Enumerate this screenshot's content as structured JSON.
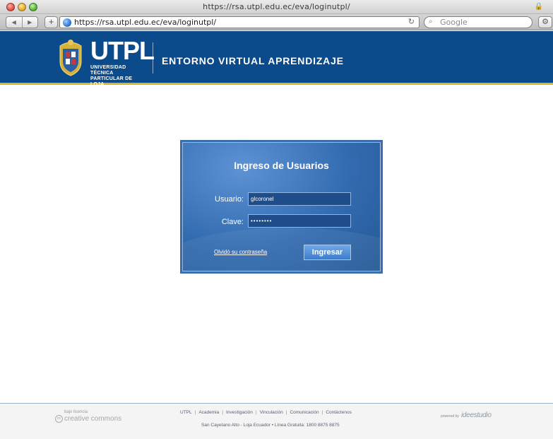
{
  "browser": {
    "window_title": "https://rsa.utpl.edu.ec/eva/loginutpl/",
    "url": "https://rsa.utpl.edu.ec/eva/loginutpl/",
    "search_placeholder": "Google",
    "nav_back": "◀",
    "nav_forward": "▶",
    "add_label": "+",
    "reload_label": "C"
  },
  "header": {
    "brand": "UTPL",
    "brand_subtitle_line1": "UNIVERSIDAD TÉCNICA",
    "brand_subtitle_line2": "PARTICULAR DE LOJA",
    "environment_title": "ENTORNO VIRTUAL APRENDIZAJE",
    "colors": {
      "background": "#0b4a8b",
      "accent": "#d9b72a"
    }
  },
  "login": {
    "title": "Ingreso de Usuarios",
    "username_label": "Usuario:",
    "username_value": "glcoronel",
    "password_label": "Clave:",
    "password_value": "••••••••",
    "forgot_link": "Olvidó su contraseña",
    "submit_label": "Ingresar"
  },
  "footer": {
    "license_label": "bajo licencia",
    "cc_label": "creative commons",
    "links": [
      "UTPL",
      "Academia",
      "Investigación",
      "Vinculación",
      "Comunicación",
      "Contáctenos"
    ],
    "address": "San Cayetano Alto - Loja Ecuador • Línea Gratuita: 1800 8875 8875",
    "powered_by": "powered by",
    "powered_brand": "ideestudio"
  }
}
